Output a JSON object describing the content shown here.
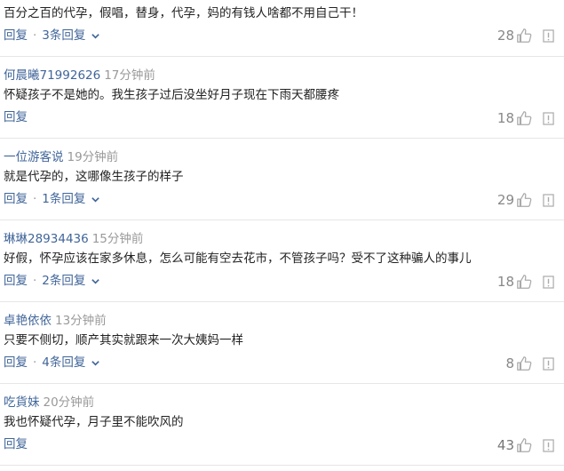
{
  "comments": [
    {
      "author": "",
      "time": "",
      "content": "百分之百的代孕，假唱，替身，代孕，妈的有钱人啥都不用自己干！",
      "reply_label": "回复",
      "replies_label": "3条回复",
      "likes": "28"
    },
    {
      "author": "何晨曦71992626",
      "time": "17分钟前",
      "content": "怀疑孩子不是她的。我生孩子过后没坐好月子现在下雨天都腰疼",
      "reply_label": "回复",
      "replies_label": "",
      "likes": "18"
    },
    {
      "author": "一位游客说",
      "time": "19分钟前",
      "content": "就是代孕的，这哪像生孩子的样子",
      "reply_label": "回复",
      "replies_label": "1条回复",
      "likes": "29"
    },
    {
      "author": "琳琳28934436",
      "time": "15分钟前",
      "content": "好假，怀孕应该在家多休息，怎么可能有空去花市，不管孩子吗？受不了这种骗人的事儿",
      "reply_label": "回复",
      "replies_label": "2条回复",
      "likes": "18"
    },
    {
      "author": "卓艳依依",
      "time": "13分钟前",
      "content": "只要不侧切，顺产其实就跟来一次大姨妈一样",
      "reply_label": "回复",
      "replies_label": "4条回复",
      "likes": "8"
    },
    {
      "author": "吃貨妹",
      "time": "20分钟前",
      "content": "我也怀疑代孕，月子里不能吹风的",
      "reply_label": "回复",
      "replies_label": "",
      "likes": "43"
    }
  ],
  "icons": {
    "like": "thumbs-up-icon",
    "report": "report-flag-icon",
    "expand": "chevron-down-icon"
  },
  "colors": {
    "author": "#406599",
    "reply_link": "#406599",
    "time": "#999999",
    "text": "#222222",
    "divider": "#e6e6e6"
  }
}
